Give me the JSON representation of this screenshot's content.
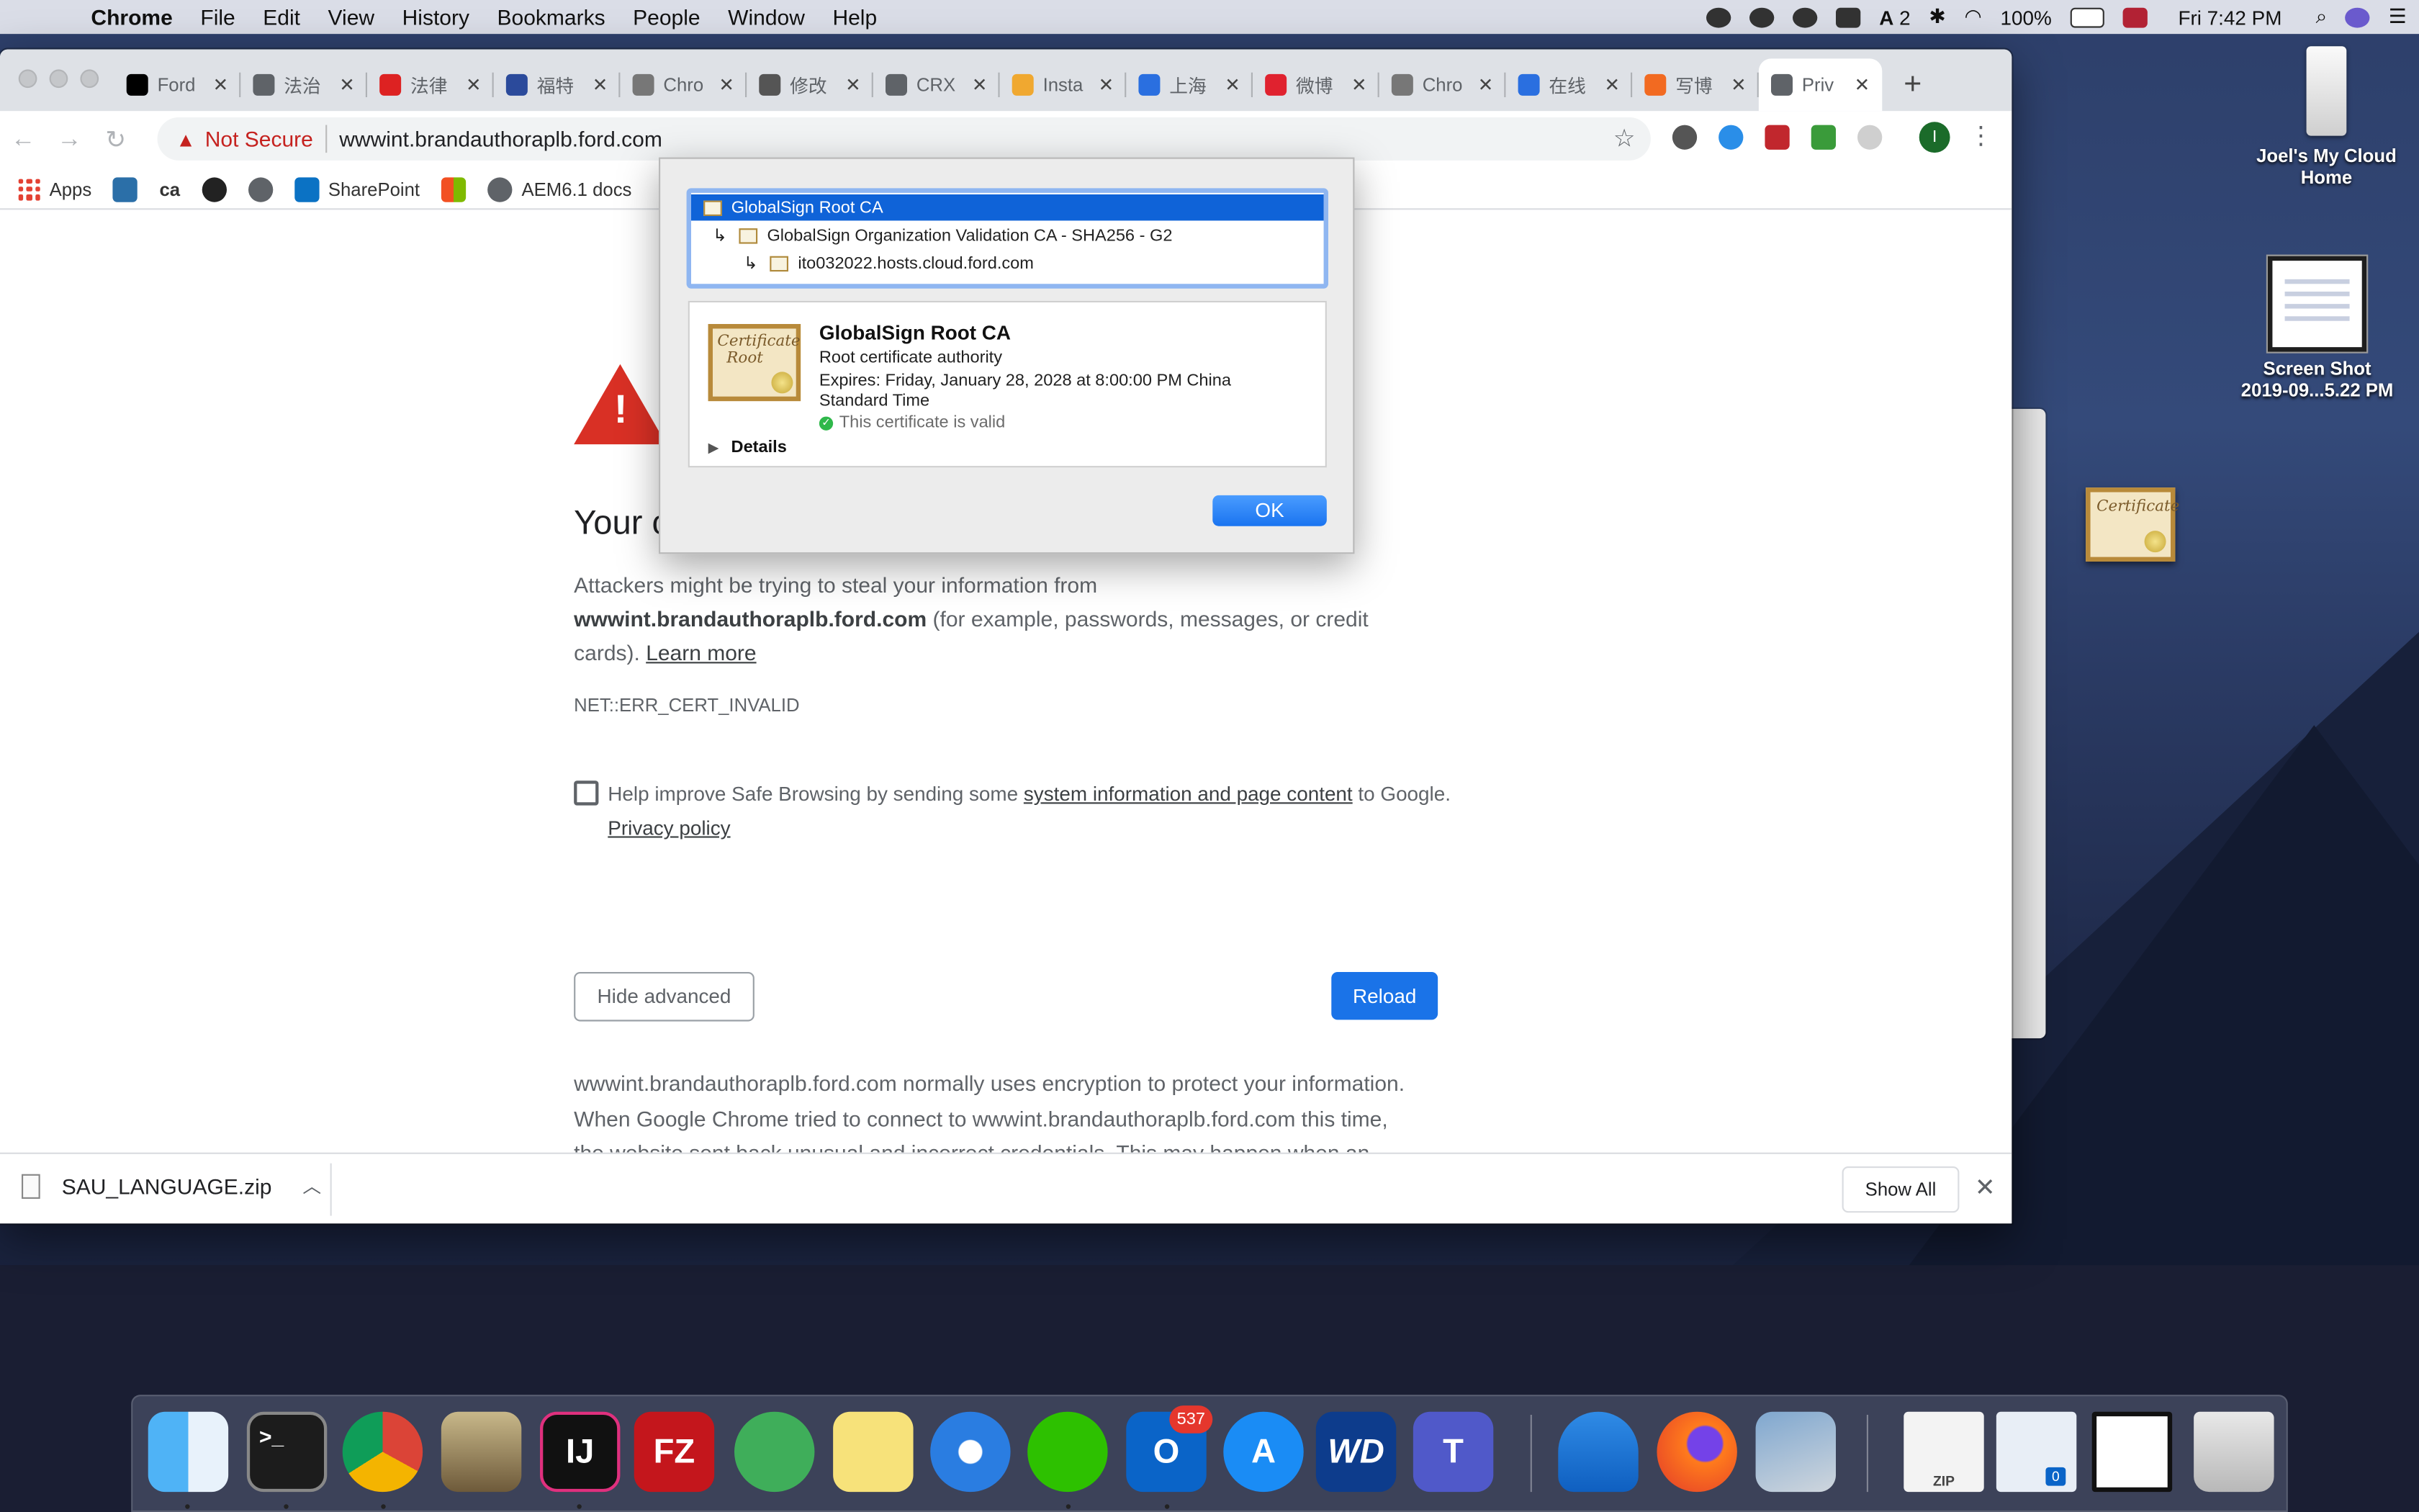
{
  "menubar": {
    "app": "Chrome",
    "items": [
      "File",
      "Edit",
      "View",
      "History",
      "Bookmarks",
      "People",
      "Window",
      "Help"
    ],
    "status": {
      "badge": "2",
      "battery": "100%",
      "clock": "Fri 7:42 PM"
    }
  },
  "desktop": {
    "drive_label_1": "Joel's My Cloud",
    "drive_label_2": "Home",
    "screenshot_label_1": "Screen Shot",
    "screenshot_label_2": "2019-09...5.22 PM"
  },
  "tabs": [
    {
      "title": "Ford",
      "color": "#000000"
    },
    {
      "title": "法治",
      "color": "#5f6368"
    },
    {
      "title": "法律",
      "color": "#d22"
    },
    {
      "title": "福特",
      "color": "#2b4a9b"
    },
    {
      "title": "Chro",
      "color": "#777"
    },
    {
      "title": "修改",
      "color": "#555"
    },
    {
      "title": "CRX",
      "color": "#5f6368"
    },
    {
      "title": "Insta",
      "color": "#f0a830"
    },
    {
      "title": "上海",
      "color": "#2a6fe0"
    },
    {
      "title": "微博",
      "color": "#e0222f"
    },
    {
      "title": "Chro",
      "color": "#777"
    },
    {
      "title": "在线",
      "color": "#2a6fe0"
    },
    {
      "title": "写博",
      "color": "#f26a21"
    },
    {
      "title": "Priv",
      "color": "#5f6368"
    }
  ],
  "omnibox": {
    "security": "Not Secure",
    "url": "wwwint.brandauthoraplb.ford.com"
  },
  "profile_initial": "I",
  "bookmarks": {
    "apps": "Apps",
    "ca": "ca",
    "sharepoint": "SharePoint",
    "aem": "AEM6.1 docs"
  },
  "page": {
    "heading": "Your c",
    "p1_a": "Attackers might be trying to steal your information from ",
    "p1_b": "wwwint.brandauthoraplb.ford.com",
    "p1_c": " (for example, passwords, messages, or credit cards). ",
    "learn_more": "Learn more",
    "error_code": "NET::ERR_CERT_INVALID",
    "safe_a": "Help improve Safe Browsing by sending some ",
    "safe_link": "system information and page content",
    "safe_b": " to Google.",
    "privacy": "Privacy policy",
    "hide_advanced": "Hide advanced",
    "reload": "Reload",
    "explain": "wwwint.brandauthoraplb.ford.com normally uses encryption to protect your information. When Google Chrome tried to connect to wwwint.brandauthoraplb.ford.com this time, the website sent back unusual and incorrect credentials. This may happen when an attacker is trying to pretend to be"
  },
  "downloads": {
    "file": "SAU_LANGUAGE.zip",
    "show_all": "Show All"
  },
  "certificate": {
    "chain": [
      "GlobalSign Root CA",
      "GlobalSign Organization Validation CA - SHA256 - G2",
      "ito032022.hosts.cloud.ford.com"
    ],
    "name": "GlobalSign Root CA",
    "type": "Root certificate authority",
    "expires": "Expires: Friday, January 28, 2028 at 8:00:00 PM China Standard Time",
    "status": "This certificate is valid",
    "details": "Details",
    "ok": "OK",
    "art_text": "Certificate",
    "art_sub": "Root"
  },
  "dock": {
    "mail_badge": "537",
    "teams_badge": "0",
    "zip_label": "ZIP"
  }
}
